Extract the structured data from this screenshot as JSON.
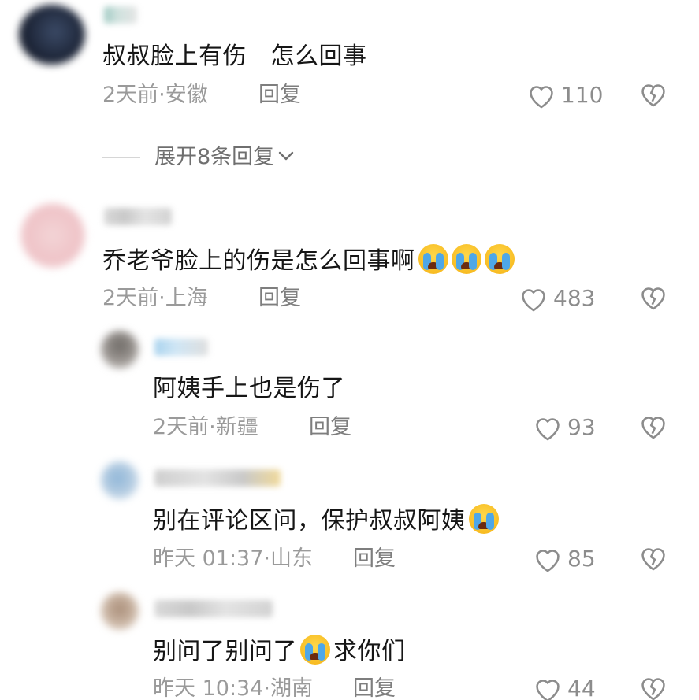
{
  "comments": [
    {
      "text": "叔叔脸上有伤　怎么回事",
      "meta": "2天前·安徽",
      "reply_label": "回复",
      "likes": "110"
    },
    {
      "text": "乔老爷脸上的伤是怎么回事啊",
      "meta": "2天前·上海",
      "reply_label": "回复",
      "likes": "483"
    },
    {
      "text": "阿姨手上也是伤了",
      "meta": "2天前·新疆",
      "reply_label": "回复",
      "likes": "93"
    },
    {
      "text": "别在评论区问，保护叔叔阿姨",
      "meta": "昨天 01:37·山东",
      "reply_label": "回复",
      "likes": "85"
    },
    {
      "text_before": "别问了别问了",
      "text_after": "求你们",
      "meta": "昨天 10:34·湖南",
      "reply_label": "回复",
      "likes": "44"
    }
  ],
  "expand_replies": "展开8条回复",
  "icons": {
    "like": "heart-outline-icon",
    "dislike": "broken-heart-icon",
    "expand": "chevron-down-icon",
    "emoji": "loudly-crying-face-emoji"
  },
  "colors": {
    "text": "#161616",
    "meta": "#9a9a9a",
    "icon": "#8c8c8c"
  }
}
